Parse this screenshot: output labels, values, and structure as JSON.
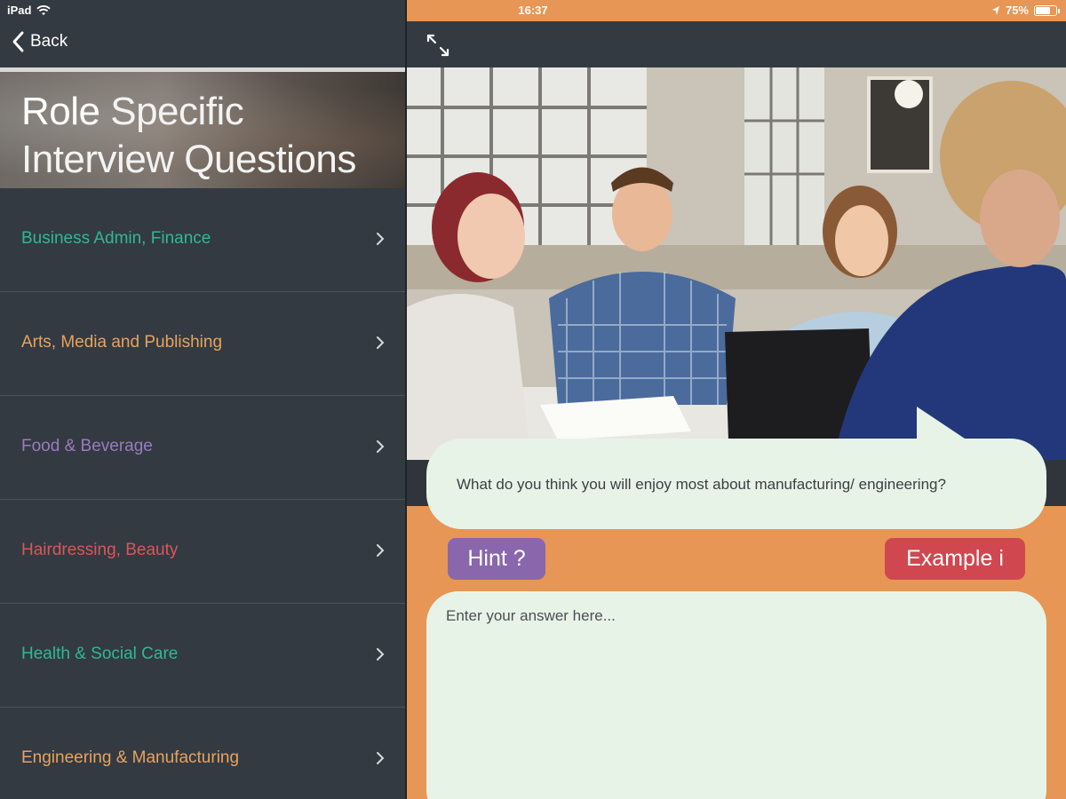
{
  "status_bar": {
    "device": "iPad",
    "time": "16:37",
    "battery_percent": "75%",
    "battery_level": 0.75
  },
  "nav": {
    "back_label": "Back"
  },
  "header": {
    "title_bold": "Role",
    "title_rest_line1": "Specific",
    "title_line2": "Interview Questions"
  },
  "menu": {
    "items": [
      {
        "label": "Business Admin, Finance",
        "color": "#2eb89a"
      },
      {
        "label": "Arts, Media and Publishing",
        "color": "#e9a25d"
      },
      {
        "label": "Food & Beverage",
        "color": "#9b7bc0"
      },
      {
        "label": "Hairdressing, Beauty",
        "color": "#de545a"
      },
      {
        "label": "Health & Social Care",
        "color": "#2eb89a"
      },
      {
        "label": "Engineering & Manufacturing",
        "color": "#e9a25d"
      }
    ]
  },
  "question": {
    "text": "What do you think you will enjoy most about manufacturing/ engineering?"
  },
  "buttons": {
    "hint_label": "Hint ?",
    "example_label": "Example i"
  },
  "answer": {
    "placeholder": "Enter your answer here..."
  },
  "colors": {
    "accent_orange": "#e79655",
    "hint_purple": "#8a66ad",
    "example_red": "#d1474f",
    "panel_dark": "#333a41",
    "bubble": "#e8f3e8"
  }
}
